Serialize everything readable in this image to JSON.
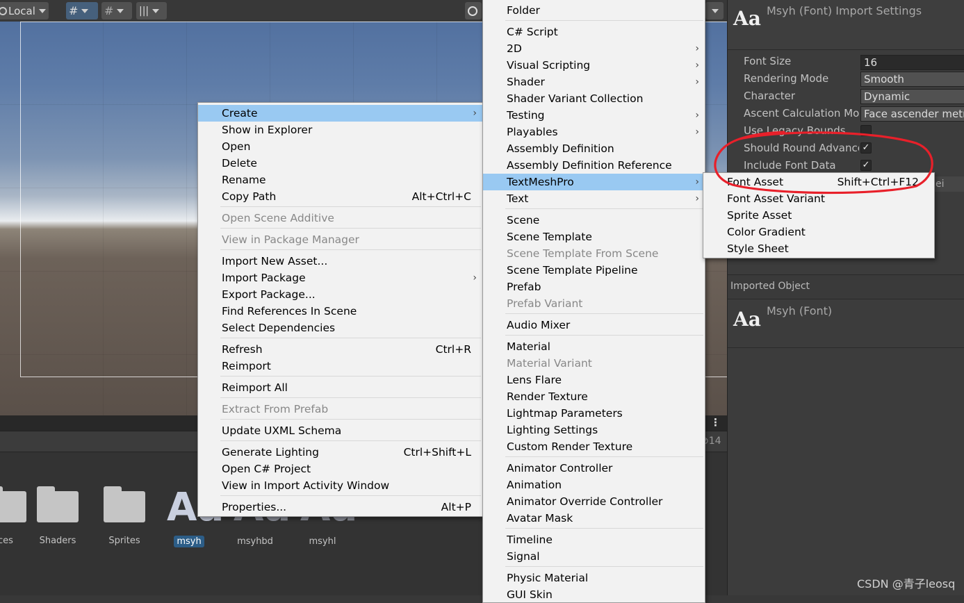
{
  "toolbar": {
    "pivot_label": "Local"
  },
  "project": {
    "assets": [
      {
        "name": "ces",
        "kind": "folder"
      },
      {
        "name": "Shaders",
        "kind": "folder"
      },
      {
        "name": "Sprites",
        "kind": "folder"
      },
      {
        "name": "msyh",
        "kind": "font"
      },
      {
        "name": "msyhbd",
        "kind": "font"
      },
      {
        "name": "msyhl",
        "kind": "font"
      }
    ],
    "count": "14",
    "font_glyph": "Aa"
  },
  "inspector": {
    "header_icon": "Aa",
    "title": "Msyh (Font) Import Settings",
    "fields": [
      {
        "label": "Font Size",
        "value": "16"
      },
      {
        "label": "Rendering Mode",
        "value": "Smooth"
      },
      {
        "label": "Character",
        "value": "Dynamic"
      },
      {
        "label": "Ascent Calculation Mo",
        "value": "Face ascender metri"
      },
      {
        "label": "Use Legacy Bounds",
        "checked": false
      },
      {
        "label": "Should Round Advance",
        "checked": true
      },
      {
        "label": "Include Font Data",
        "checked": true
      }
    ],
    "partial_text": "ei",
    "imported_object_label": "Imported Object",
    "imported_icon": "Aa",
    "imported_name": "Msyh (Font)"
  },
  "context_menu": {
    "items": [
      {
        "label": "Create",
        "shortcut": "",
        "submenu": true,
        "highlighted": true
      },
      {
        "label": "Show in Explorer",
        "shortcut": ""
      },
      {
        "label": "Open",
        "shortcut": ""
      },
      {
        "label": "Delete",
        "shortcut": ""
      },
      {
        "label": "Rename",
        "shortcut": ""
      },
      {
        "label": "Copy Path",
        "shortcut": "Alt+Ctrl+C"
      },
      {
        "label": "Open Scene Additive",
        "disabled": true
      },
      {
        "label": "View in Package Manager",
        "disabled": true
      },
      {
        "label": "Import New Asset..."
      },
      {
        "label": "Import Package",
        "submenu": true
      },
      {
        "label": "Export Package..."
      },
      {
        "label": "Find References In Scene"
      },
      {
        "label": "Select Dependencies"
      },
      {
        "label": "Refresh",
        "shortcut": "Ctrl+R"
      },
      {
        "label": "Reimport"
      },
      {
        "label": "Reimport All"
      },
      {
        "label": "Extract From Prefab",
        "disabled": true
      },
      {
        "label": "Update UXML Schema"
      },
      {
        "label": "Generate Lighting",
        "shortcut": "Ctrl+Shift+L"
      },
      {
        "label": "Open C# Project"
      },
      {
        "label": "View in Import Activity Window"
      },
      {
        "label": "Properties...",
        "shortcut": "Alt+P"
      }
    ]
  },
  "create_menu": {
    "items": [
      {
        "label": "Folder"
      },
      {
        "label": "C# Script"
      },
      {
        "label": "2D",
        "submenu": true
      },
      {
        "label": "Visual Scripting",
        "submenu": true
      },
      {
        "label": "Shader",
        "submenu": true
      },
      {
        "label": "Shader Variant Collection"
      },
      {
        "label": "Testing",
        "submenu": true
      },
      {
        "label": "Playables",
        "submenu": true
      },
      {
        "label": "Assembly Definition"
      },
      {
        "label": "Assembly Definition Reference"
      },
      {
        "label": "TextMeshPro",
        "submenu": true,
        "highlighted": true
      },
      {
        "label": "Text",
        "submenu": true
      },
      {
        "label": "Scene"
      },
      {
        "label": "Scene Template"
      },
      {
        "label": "Scene Template From Scene",
        "disabled": true
      },
      {
        "label": "Scene Template Pipeline"
      },
      {
        "label": "Prefab"
      },
      {
        "label": "Prefab Variant",
        "disabled": true
      },
      {
        "label": "Audio Mixer"
      },
      {
        "label": "Material"
      },
      {
        "label": "Material Variant",
        "disabled": true
      },
      {
        "label": "Lens Flare"
      },
      {
        "label": "Render Texture"
      },
      {
        "label": "Lightmap Parameters"
      },
      {
        "label": "Lighting Settings"
      },
      {
        "label": "Custom Render Texture"
      },
      {
        "label": "Animator Controller"
      },
      {
        "label": "Animation"
      },
      {
        "label": "Animator Override Controller"
      },
      {
        "label": "Avatar Mask"
      },
      {
        "label": "Timeline"
      },
      {
        "label": "Signal"
      },
      {
        "label": "Physic Material"
      },
      {
        "label": "GUI Skin"
      }
    ]
  },
  "textmeshpro_menu": {
    "items": [
      {
        "label": "Font Asset",
        "shortcut": "Shift+Ctrl+F12"
      },
      {
        "label": "Font Asset Variant"
      },
      {
        "label": "Sprite Asset"
      },
      {
        "label": "Color Gradient"
      },
      {
        "label": "Style Sheet"
      }
    ]
  },
  "annotation_color": "#e8202a",
  "watermark": "CSDN @青子leosq"
}
